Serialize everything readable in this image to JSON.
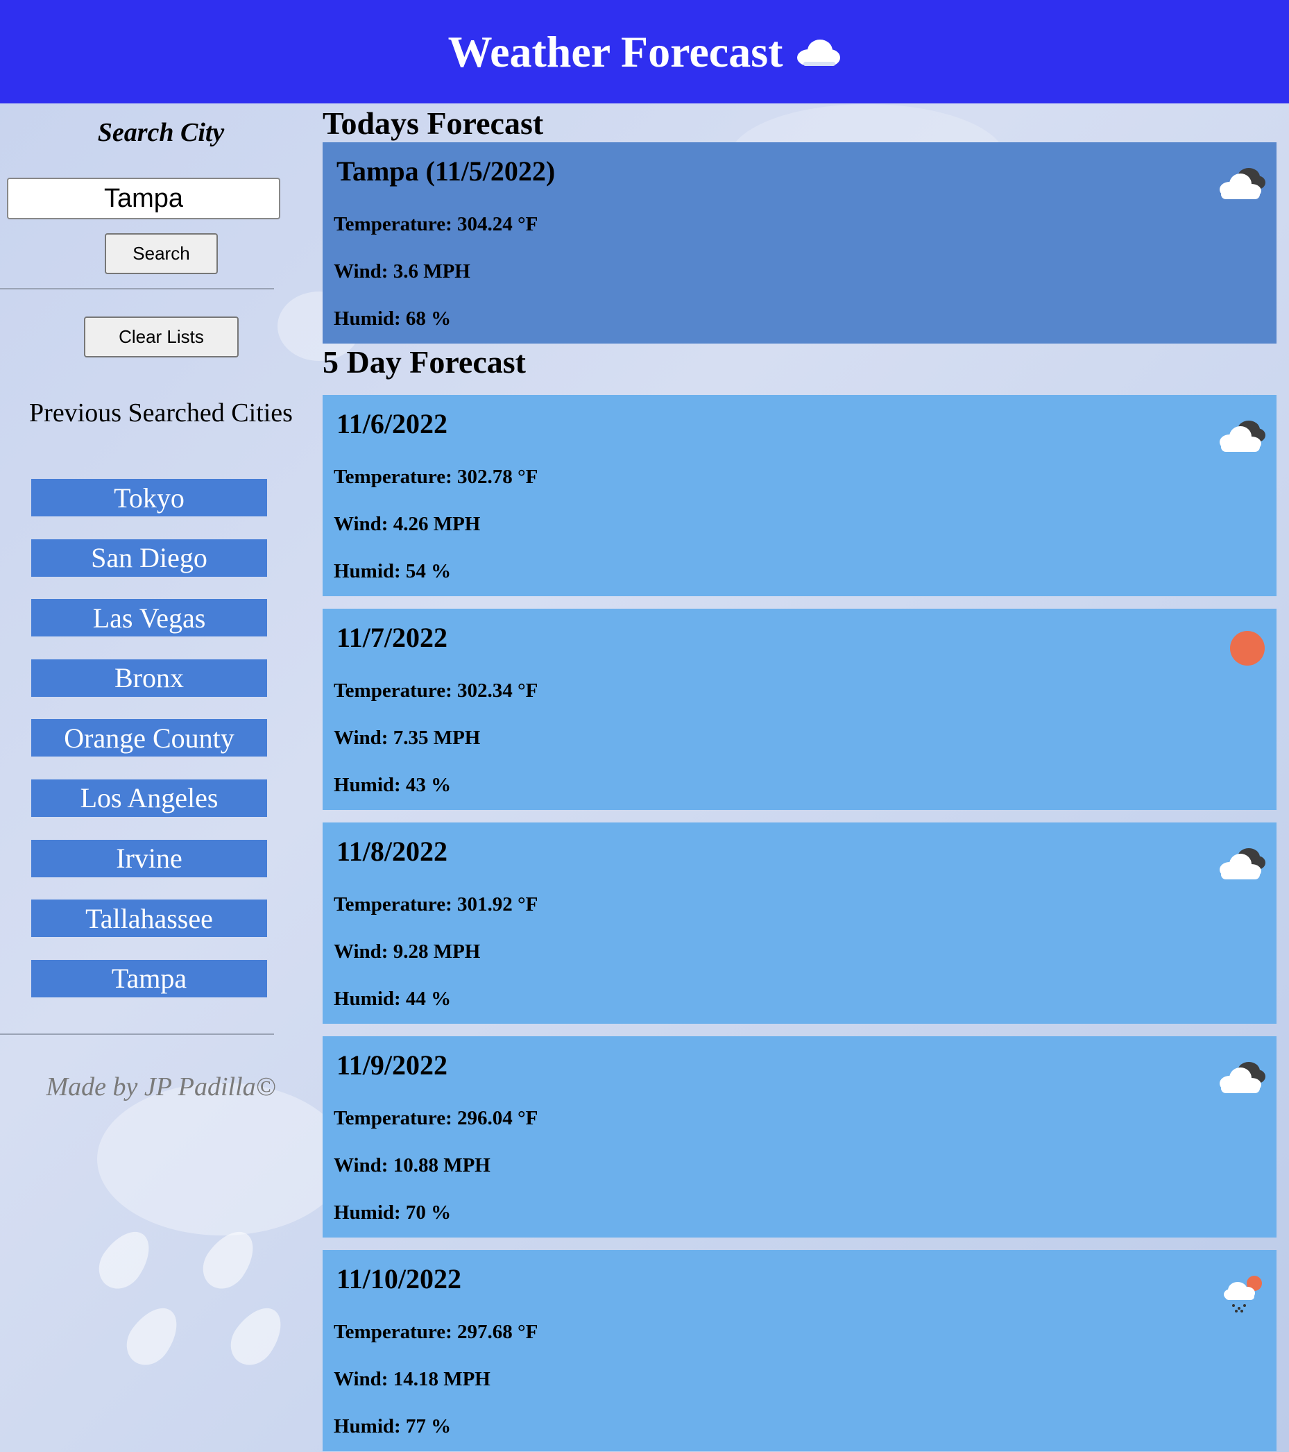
{
  "header": {
    "title": "Weather Forecast",
    "icon": "cloud-icon"
  },
  "sidebar": {
    "search_heading": "Search City",
    "search_input_value": "Tampa",
    "search_button": "Search",
    "clear_button": "Clear Lists",
    "previous_heading": "Previous Searched Cities",
    "cities": [
      "Tokyo",
      "San Diego",
      "Las Vegas",
      "Bronx",
      "Orange County",
      "Los Angeles",
      "Irvine",
      "Tallahassee",
      "Tampa"
    ],
    "credit": "Made by JP Padilla©"
  },
  "today": {
    "heading": "Todays Forecast",
    "title": "Tampa (11/5/2022)",
    "temperature": "Temperature: 304.24 °F",
    "wind": "Wind: 3.6 MPH",
    "humid": "Humid: 68 %",
    "icon": "broken-clouds-icon"
  },
  "forecast": {
    "heading": "5 Day Forecast",
    "days": [
      {
        "date": "11/6/2022",
        "temperature": "Temperature: 302.78 °F",
        "wind": "Wind: 4.26 MPH",
        "humid": "Humid: 54 %",
        "icon": "broken-clouds-icon"
      },
      {
        "date": "11/7/2022",
        "temperature": "Temperature: 302.34 °F",
        "wind": "Wind: 7.35 MPH",
        "humid": "Humid: 43 %",
        "icon": "clear-sun-icon"
      },
      {
        "date": "11/8/2022",
        "temperature": "Temperature: 301.92 °F",
        "wind": "Wind: 9.28 MPH",
        "humid": "Humid: 44 %",
        "icon": "broken-clouds-icon"
      },
      {
        "date": "11/9/2022",
        "temperature": "Temperature: 296.04 °F",
        "wind": "Wind: 10.88 MPH",
        "humid": "Humid: 70 %",
        "icon": "broken-clouds-icon"
      },
      {
        "date": "11/10/2022",
        "temperature": "Temperature: 297.68 °F",
        "wind": "Wind: 14.18 MPH",
        "humid": "Humid: 77 %",
        "icon": "rain-sun-icon"
      }
    ]
  },
  "colors": {
    "header_bg": "#2f2ff0",
    "today_card": "#5686cc",
    "day_card": "#6cb0ec",
    "city_button": "#477ed6",
    "sun": "#ec6e4c"
  }
}
